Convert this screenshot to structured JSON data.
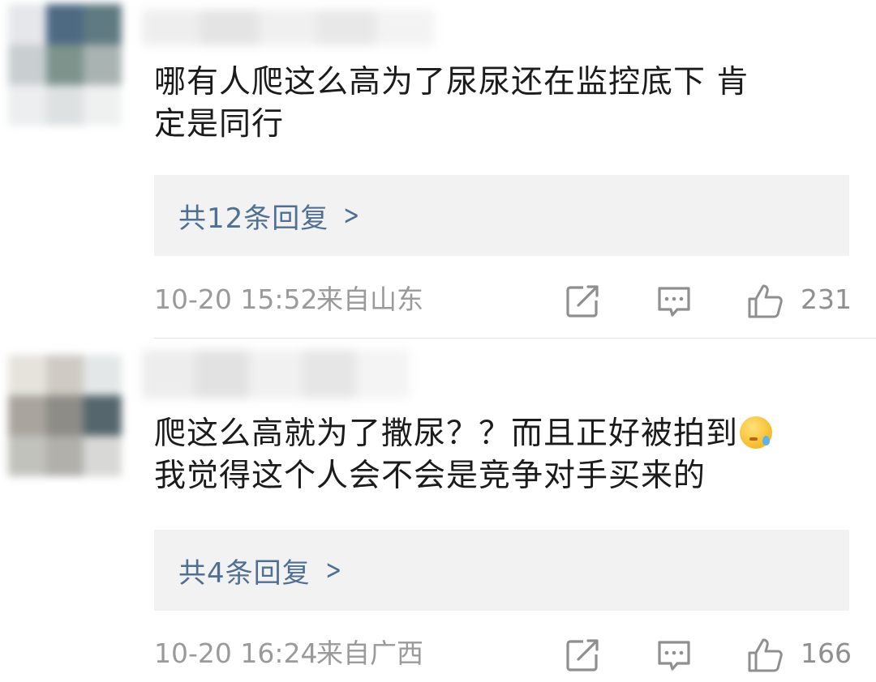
{
  "comments": [
    {
      "text_line1": "哪有人爬这么高为了尿尿还在监控底下 肯",
      "text_line2": "定是同行",
      "replies_label": "共12条回复",
      "time": "10-20 15:52",
      "location": "来自山东",
      "likes": "231",
      "avatar_colors": [
        "#e5e7ea",
        "#4e6a83",
        "#5f7a82",
        "#c9cfd1",
        "#7d938c",
        "#a9b3b2",
        "#eceeef",
        "#dde1e2",
        "#eff1f1"
      ]
    },
    {
      "text_line1": "爬这么高就为了撒尿？？而且正好被拍到",
      "text_line2": "我觉得这个人会不会是竞争对手买来的",
      "emoji": "sweat-emoji",
      "replies_label": "共4条回复",
      "time": "10-20 16:24",
      "location": "来自广西",
      "likes": "166",
      "avatar_colors": [
        "#e6e3dd",
        "#cfcac4",
        "#e4e7e8",
        "#aaa49e",
        "#8e8c87",
        "#55666d",
        "#c2c2bd",
        "#b1b0aa",
        "#d8d9d6"
      ]
    }
  ],
  "icons": {
    "share": "share-icon",
    "comment": "comment-icon",
    "like": "thumbs-up-icon",
    "chevron": "chevron-right-icon"
  },
  "chevron_glyph": ">",
  "colors": {
    "reply_link": "#4f6f93",
    "meta_text": "#9a9a9a",
    "reply_box_bg": "#f2f2f2"
  }
}
